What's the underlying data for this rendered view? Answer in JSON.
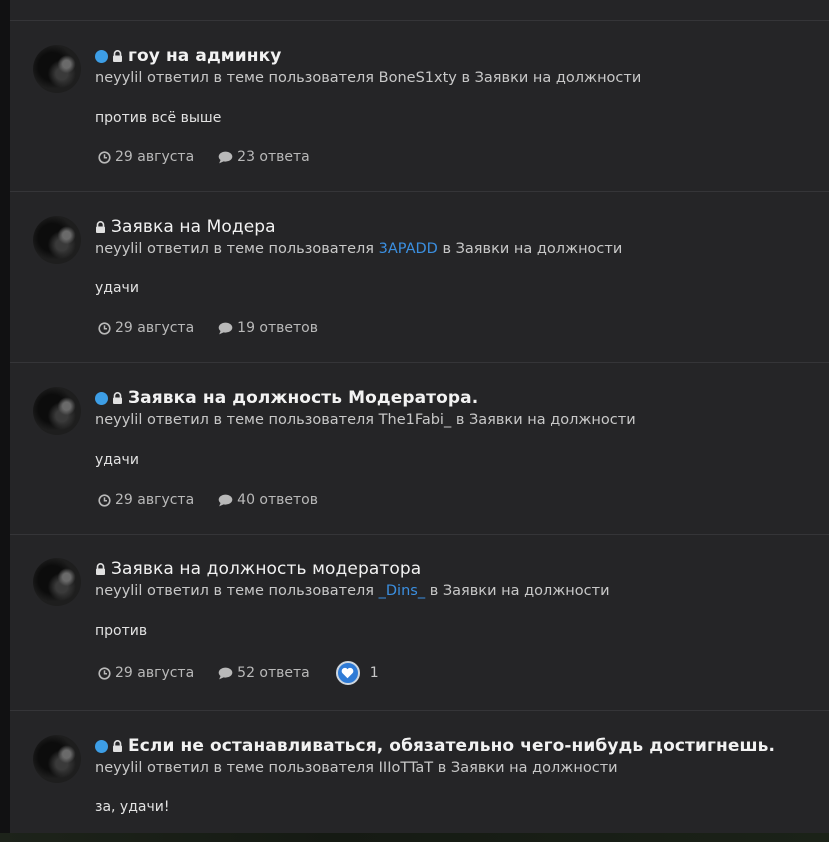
{
  "entries": [
    {
      "unread": true,
      "title": "гоу на админку",
      "title_bold": true,
      "author": "neyylil",
      "action": " ответил в теме пользователя ",
      "topic_user": "BoneS1xty",
      "topic_user_link": false,
      "forum_prefix": " в ",
      "forum": "Заявки на должности",
      "snippet": "против всё выше",
      "date": "29 августа",
      "replies": "23 ответа",
      "likes": null
    },
    {
      "unread": false,
      "title": "Заявка на Модера",
      "title_bold": false,
      "author": "neyylil",
      "action": " ответил в теме пользователя ",
      "topic_user": "3APADD",
      "topic_user_link": true,
      "forum_prefix": " в ",
      "forum": "Заявки на должности",
      "snippet": "удачи",
      "date": "29 августа",
      "replies": "19 ответов",
      "likes": null
    },
    {
      "unread": true,
      "title": "Заявка на должность Модератора.",
      "title_bold": true,
      "author": "neyylil",
      "action": " ответил в теме пользователя ",
      "topic_user": "The1Fabi_",
      "topic_user_link": false,
      "forum_prefix": " в ",
      "forum": "Заявки на должности",
      "snippet": "удачи",
      "date": "29 августа",
      "replies": "40 ответов",
      "likes": null
    },
    {
      "unread": false,
      "title": "Заявка на должность модератора",
      "title_bold": false,
      "author": "neyylil",
      "action": " ответил в теме пользователя ",
      "topic_user": "_Dins_",
      "topic_user_link": true,
      "forum_prefix": " в ",
      "forum": "Заявки на должности",
      "snippet": "против",
      "date": "29 августа",
      "replies": "52 ответа",
      "likes": "1"
    },
    {
      "unread": true,
      "title": "Если не останавливаться, обязательно чего-нибудь достигнешь.",
      "title_bold": true,
      "author": "neyylil",
      "action": " ответил в теме пользователя ",
      "topic_user": "IIIoTTaT",
      "topic_user_link": false,
      "forum_prefix": " в ",
      "forum": "Заявки на должности",
      "snippet": "за, удачи!",
      "date": null,
      "replies": null,
      "likes": null
    }
  ],
  "colors": {
    "unread_dot": "#3d9ee6",
    "user_link": "#3b8fe0",
    "like_badge": "#2f7bd6"
  },
  "icons": {
    "lock": "lock-icon",
    "date": "clock-icon",
    "replies": "comment-icon",
    "like": "heart-icon"
  }
}
